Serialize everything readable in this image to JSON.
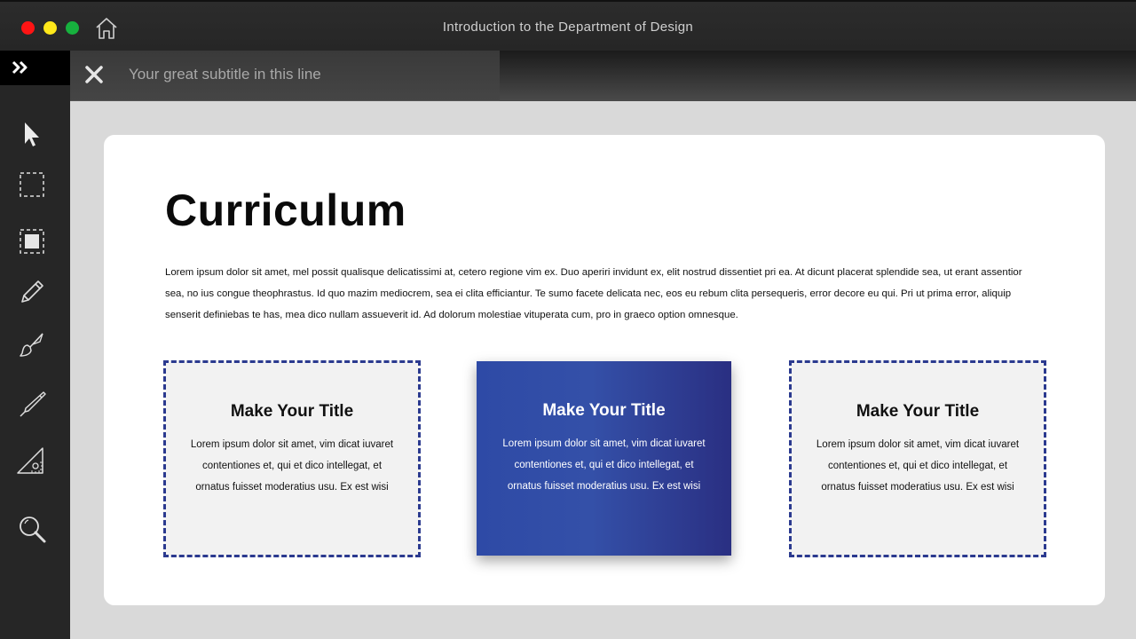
{
  "window": {
    "title": "Introduction to the Department of Design",
    "controls": [
      "close",
      "minimize",
      "maximize"
    ],
    "home_icon": "home-icon"
  },
  "toolbar": {
    "subtitle": "Your great subtitle in this line",
    "close_icon": "close-icon"
  },
  "sidebar": {
    "expand_icon": "double-chevron-right-icon",
    "tools": [
      "pointer-icon",
      "select-rectangle-icon",
      "filled-rectangle-icon",
      "pencil-icon",
      "brush-icon",
      "pen-icon",
      "set-square-icon",
      "magnifier-icon"
    ]
  },
  "slide": {
    "title": "Curriculum",
    "body": "Lorem ipsum dolor sit amet, mel possit qualisque delicatissimi at, cetero regione vim ex. Duo aperiri invidunt ex, elit nostrud dissentiet pri ea. At dicunt placerat splendide sea, ut erant assentior sea, no ius congue theophrastus. Id quo mazim mediocrem, sea ei clita efficiantur. Te sumo facete delicata nec, eos eu rebum clita persequeris, error decore eu qui. Pri ut prima error, aliquip senserit definiebas te has, mea dico nullam assueverit id. Ad dolorum molestiae vituperata cum, pro in graeco option omnesque.",
    "cards": [
      {
        "title": "Make Your Title",
        "text": "Lorem ipsum dolor sit amet, vim dicat iuvaret contentiones et, qui et dico intellegat, et ornatus fuisset moderatius usu. Ex est wisi"
      },
      {
        "title": "Make Your Title",
        "text": "Lorem ipsum dolor sit amet, vim dicat iuvaret contentiones et, qui et dico intellegat, et ornatus fuisset moderatius usu. Ex est wisi"
      },
      {
        "title": "Make Your Title",
        "text": "Lorem ipsum dolor sit amet, vim dicat iuvaret contentiones et, qui et dico intellegat, et ornatus fuisset moderatius usu. Ex est wisi"
      }
    ]
  },
  "colors": {
    "accent_blue": "#2e4aa6",
    "dash_border": "#2b3a8f",
    "close_red": "#ff1414",
    "minimize_yellow": "#ffe81a",
    "maximize_green": "#17b13e"
  }
}
